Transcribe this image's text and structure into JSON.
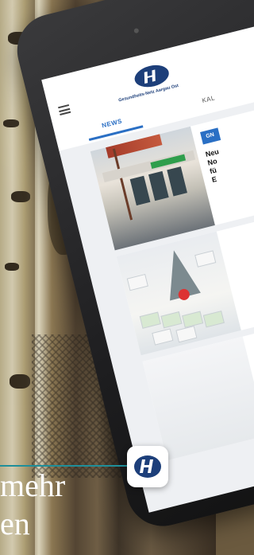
{
  "app": {
    "brand_name": "Gesundheits-Netz Aargau Ost",
    "tabs": [
      {
        "label": "NEWS",
        "active": true
      },
      {
        "label": "KAL",
        "active": false
      }
    ]
  },
  "feed": [
    {
      "badge": "GN",
      "title": "Neu\nNo\nfü\nE"
    },
    {
      "badge": "",
      "title": ""
    },
    {
      "badge": "",
      "title": ""
    }
  ],
  "overlay": {
    "headline_line1": "mehr",
    "headline_line2": "en"
  },
  "colors": {
    "accent_blue": "#2a6fc4",
    "teal_line": "#1f8f9a",
    "brand_navy": "#1d3f7a"
  },
  "icons": [
    "menu-icon",
    "brand-logo-icon",
    "app-icon"
  ]
}
